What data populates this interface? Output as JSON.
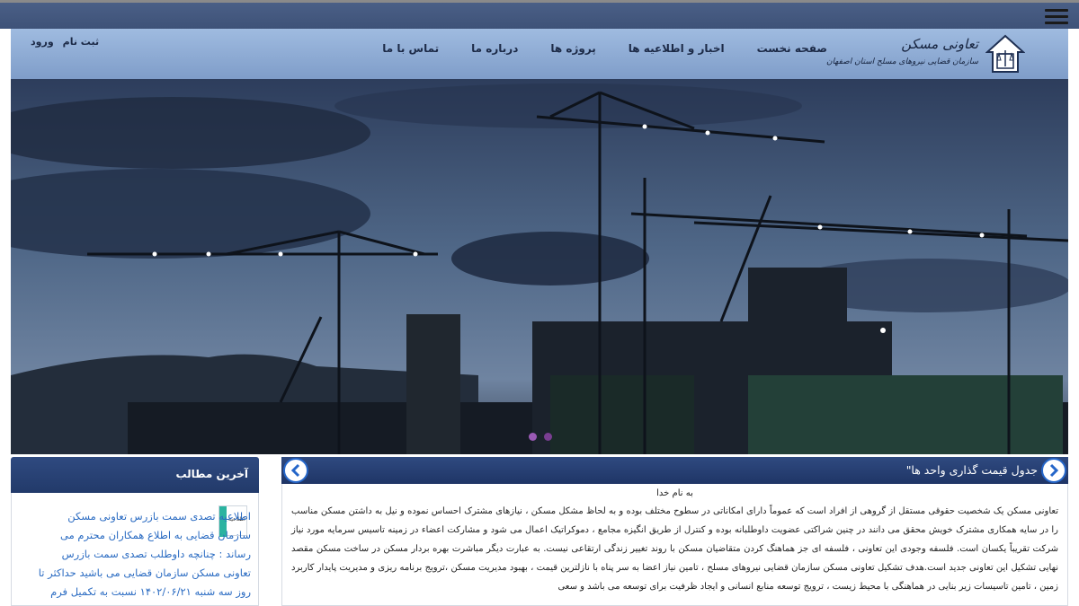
{
  "header": {
    "logo_title": "تعاونی مسکن",
    "logo_subtitle": "سازمان قضایی نیروهای مسلح استان اصفهان",
    "nav": [
      {
        "label": "صفحه نخست"
      },
      {
        "label": "اخبار و اطلاعیه ها"
      },
      {
        "label": "پروژه ها"
      },
      {
        "label": "درباره ما"
      },
      {
        "label": "تماس با ما"
      }
    ],
    "register_label": "ثبت نام",
    "login_label": "ورود"
  },
  "slider": {
    "dot_count": 2,
    "active_dot": 1
  },
  "sidebar": {
    "title": "آخرین مطالب",
    "thumb_label": "اطلاعیه",
    "news_text": "اطلاعیه تصدی سمت بازرس تعاونی مسکن سازمان قضایی به اطلاع همکاران محترم می رساند : چنانچه داوطلب تصدی سمت بازرس تعاونی مسکن سازمان قضایی می باشید حداکثر تا روز سه شنبه ۱۴۰۲/۰۶/۲۱ نسبت به تکمیل فرم د..."
  },
  "ticker": {
    "text": "جدول قیمت گذاری واحد ها\""
  },
  "article": {
    "heading": "به نام خدا",
    "body": "تعاونی مسکن یک شخصیت حقوقی مستقل از گروهی از افراد است که عموماً دارای امکاناتی در سطوح مختلف بوده و به لحاظ مشکل مسکن ، نیازهای مشترک احساس نموده و نیل به داشتن مسکن مناسب را در سایه همکاری مشترک خویش محقق می دانند در چنین شراکتی عضویت داوطلبانه بوده و کنترل از طریق انگیزه مجامع ، دموکراتیک اعمال می شود و مشارکت اعضاء در زمینه تاسیس سرمایه مورد نیاز شرکت تقریباً یکسان است. فلسفه وجودی این تعاونی ، فلسفه ای جز هماهنگ کردن متقاضیان مسکن با روند تغییر زندگی ارتقاعی نیست. به عبارت دیگر مباشرت بهره بردار مسکن در ساخت مسکن مقصد نهایی تشکیل این تعاونی جدید است.هدف تشکیل تعاونی مسکن سازمان قضایی نیروهای مسلح ، تامین نیاز اعضا به سر پناه با نازلترین قیمت ، بهبود مدیریت مسکن ،ترویج برنامه ریزی و مدیریت پایدار کاربرد زمین ، تامین تاسیسات زیر بنایی در هماهنگی با محیط زیست ، ترویج توسعه منابع انسانی و ایجاد ظرفیت برای توسعه می باشد و سعی"
  },
  "colors": {
    "topbar": "#3e5278",
    "header": "#8fadd6",
    "panel_head": "#2a4376",
    "link": "#2a6bc2"
  }
}
